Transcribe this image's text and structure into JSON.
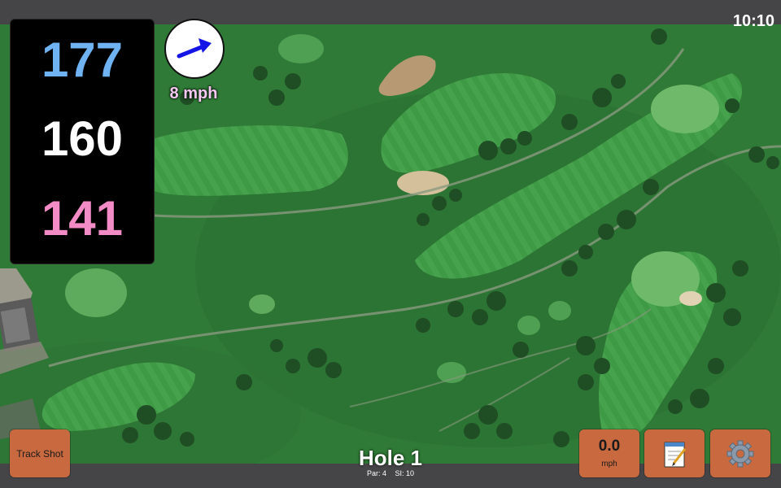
{
  "status_bar": {
    "time": "10:10"
  },
  "distances": {
    "front": {
      "value": "177",
      "color": "#6fb3f2"
    },
    "middle": {
      "value": "160",
      "color": "#ffffff"
    },
    "back": {
      "value": "141",
      "color": "#f38cc6"
    }
  },
  "wind": {
    "speed_text": "8 mph",
    "text_color": "#f6c8f2",
    "arrow_icon": "wind-direction-arrow-icon",
    "arrow_color": "#1414e6"
  },
  "map": {
    "view": "satellite-course-map"
  },
  "buttons": {
    "track_shot_label": "Track Shot",
    "speed_value": "0.0",
    "speed_unit": "mph",
    "notes_icon": "notepad-icon",
    "settings_icon": "gear-icon",
    "accent_color": "#c8693f"
  },
  "hole": {
    "title": "Hole 1",
    "par_label": "Par: 4",
    "si_label": "SI: 10"
  }
}
